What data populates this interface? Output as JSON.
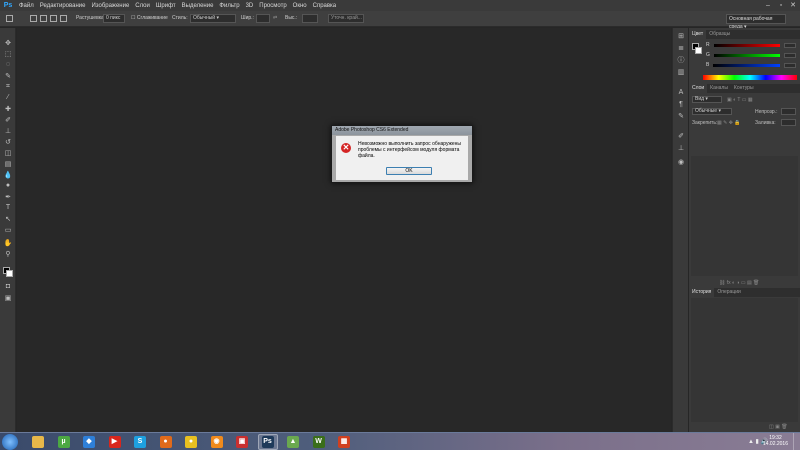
{
  "app": {
    "logo": "Ps"
  },
  "menubar": {
    "items": [
      "Файл",
      "Редактирование",
      "Изображение",
      "Слои",
      "Шрифт",
      "Выделение",
      "Фильтр",
      "3D",
      "Просмотр",
      "Окно",
      "Справка"
    ]
  },
  "optionsbar": {
    "feather_label": "Растушевка:",
    "feather_value": "0 пикс",
    "antialias_label": "Сглаживание",
    "style_label": "Стиль:",
    "style_value": "Обычный",
    "width_label": "Шир.:",
    "height_label": "Выс.:",
    "refine_button": "Уточн. край...",
    "workspace": "Основная рабочая среда"
  },
  "color_panel": {
    "tabs": [
      "Цвет",
      "Образцы"
    ],
    "sliders": [
      {
        "label": "R",
        "color": "#d94040"
      },
      {
        "label": "G",
        "color": "#40b040"
      },
      {
        "label": "B",
        "color": "#4060d0"
      }
    ]
  },
  "layers_panel": {
    "tabs": [
      "Слои",
      "Каналы",
      "Контуры"
    ],
    "kind_label": "Вид",
    "blend_value": "Обычные",
    "opacity_label": "Непрозр.:",
    "lock_label": "Закрепить:",
    "fill_label": "Заливка:"
  },
  "history_panel": {
    "tabs": [
      "История",
      "Операции"
    ]
  },
  "dialog": {
    "title": "Adobe Photoshop CS6 Extended",
    "message": "Невозможно выполнить запрос обнаружены проблемы с интерфейсом модуля формата файла.",
    "ok_label": "OK"
  },
  "taskbar": {
    "apps": [
      {
        "name": "file-explorer",
        "color": "#e8b84a",
        "glyph": ""
      },
      {
        "name": "utorrent",
        "color": "#4ca843",
        "glyph": "µ"
      },
      {
        "name": "dropbox",
        "color": "#2e7fd8",
        "glyph": "◆"
      },
      {
        "name": "youtube",
        "color": "#d9261c",
        "glyph": "▶"
      },
      {
        "name": "skype",
        "color": "#1ea0e0",
        "glyph": "S"
      },
      {
        "name": "firefox",
        "color": "#e06a1b",
        "glyph": "●"
      },
      {
        "name": "chrome",
        "color": "#e8c020",
        "glyph": "●"
      },
      {
        "name": "blender",
        "color": "#f08a1c",
        "glyph": "◉"
      },
      {
        "name": "media-player",
        "color": "#c83030",
        "glyph": "▣"
      },
      {
        "name": "photoshop",
        "color": "#1e3a5a",
        "glyph": "Ps"
      },
      {
        "name": "photo-viewer",
        "color": "#6aa84f",
        "glyph": "▲"
      },
      {
        "name": "word-app",
        "color": "#3a6e1a",
        "glyph": "W"
      },
      {
        "name": "office-app",
        "color": "#d04020",
        "glyph": "▦"
      }
    ],
    "clock_time": "19:32",
    "clock_date": "14.02.2016"
  }
}
